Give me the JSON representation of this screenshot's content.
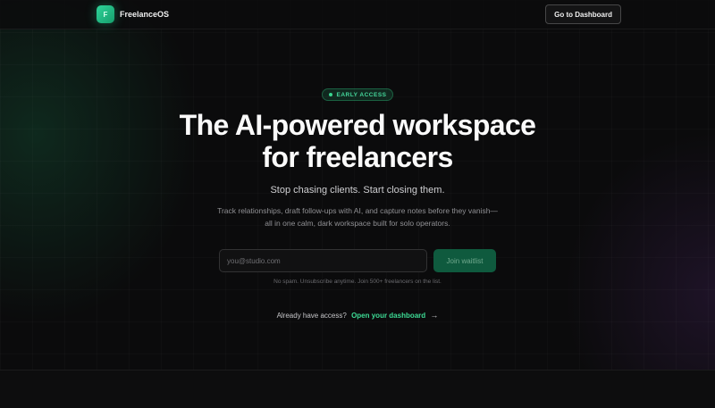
{
  "header": {
    "logo_letter": "F",
    "brand_name": "FreelanceOS",
    "dashboard_button": "Go to Dashboard"
  },
  "hero": {
    "badge": "EARLY ACCESS",
    "title_line1": "The AI-powered workspace",
    "title_line2": "for freelancers",
    "subtitle": "Stop chasing clients. Start closing them.",
    "description": "Track relationships, draft follow-ups with AI, and capture notes before they vanish—all in one calm, dark workspace built for solo operators."
  },
  "form": {
    "email_placeholder": "you@studio.com",
    "email_value": "",
    "join_button": "Join waitlist",
    "note": "No spam. Unsubscribe anytime. Join 500+ freelancers on the list."
  },
  "access": {
    "prompt": "Already have access?",
    "link": "Open your dashboard",
    "arrow": "→"
  },
  "colors": {
    "accent": "#3ddb95",
    "background": "#0b0b0c",
    "button_green": "#0f5a3e"
  },
  "icons": {
    "logo": "logo-icon",
    "badge_dot": "dot-icon",
    "arrow": "arrow-right-icon"
  }
}
